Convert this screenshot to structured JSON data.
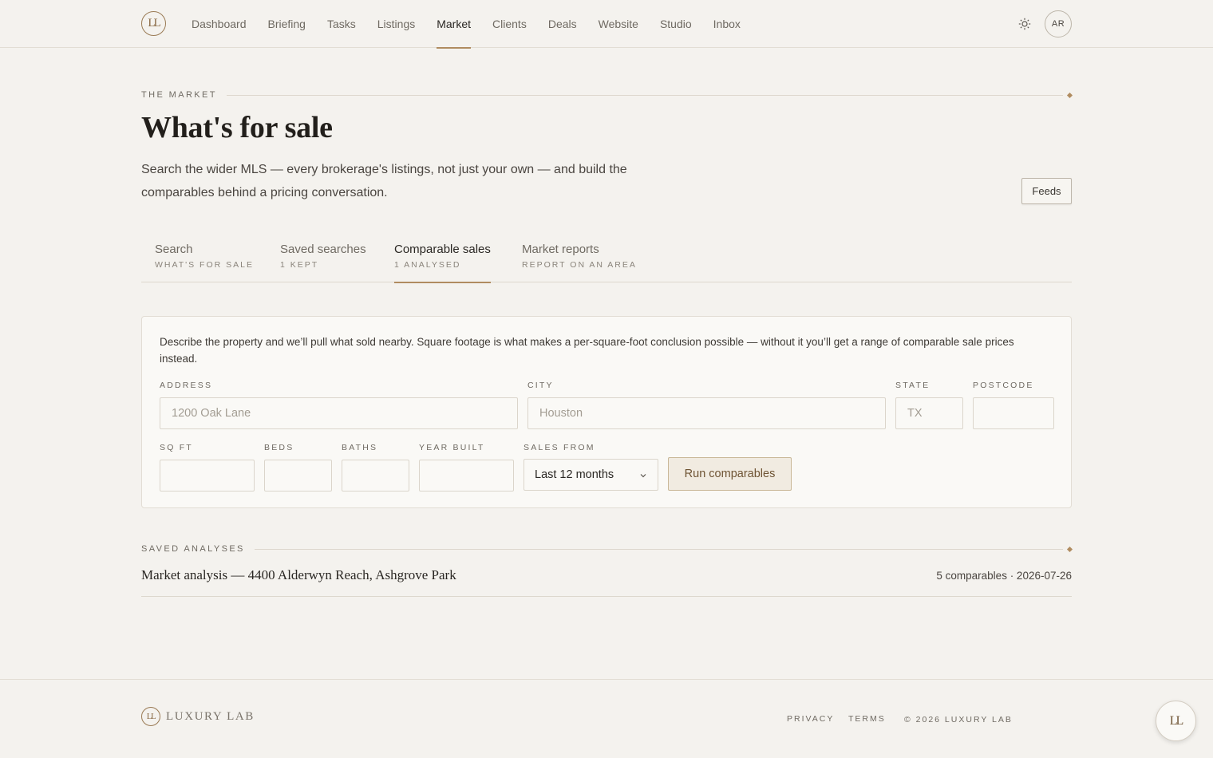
{
  "brand": {
    "logo_mark": "LL",
    "footer_name": "LUXURY LAB"
  },
  "nav": {
    "items": [
      {
        "label": "Dashboard"
      },
      {
        "label": "Briefing"
      },
      {
        "label": "Tasks"
      },
      {
        "label": "Listings"
      },
      {
        "label": "Market",
        "active": true
      },
      {
        "label": "Clients"
      },
      {
        "label": "Deals"
      },
      {
        "label": "Website"
      },
      {
        "label": "Studio"
      },
      {
        "label": "Inbox"
      }
    ],
    "theme_icon": "sun-icon",
    "avatar_initials": "AR"
  },
  "header": {
    "eyebrow": "THE MARKET",
    "title": "What's for sale",
    "intro": "Search the wider MLS — every brokerage's listings, not just your own — and build the comparables behind a pricing conversation.",
    "feeds_label": "Feeds"
  },
  "tabs": [
    {
      "label": "Search",
      "sub": "WHAT'S FOR SALE"
    },
    {
      "label": "Saved searches",
      "sub": "1 KEPT"
    },
    {
      "label": "Comparable sales",
      "sub": "1 ANALYSED",
      "active": true
    },
    {
      "label": "Market reports",
      "sub": "REPORT ON AN AREA"
    }
  ],
  "form": {
    "description": "Describe the property and we’ll pull what sold nearby. Square footage is what makes a per-square-foot conclusion possible — without it you’ll get a range of comparable sale prices instead.",
    "address": {
      "label": "ADDRESS",
      "placeholder": "1200 Oak Lane",
      "value": ""
    },
    "city": {
      "label": "CITY",
      "placeholder": "Houston",
      "value": ""
    },
    "state": {
      "label": "STATE",
      "placeholder": "TX",
      "value": ""
    },
    "postcode": {
      "label": "POSTCODE",
      "placeholder": "",
      "value": ""
    },
    "sqft": {
      "label": "SQ FT",
      "value": ""
    },
    "beds": {
      "label": "BEDS",
      "value": ""
    },
    "baths": {
      "label": "BATHS",
      "value": ""
    },
    "year_built": {
      "label": "YEAR BUILT",
      "value": ""
    },
    "sales_from": {
      "label": "SALES FROM",
      "selected": "Last 12 months"
    },
    "run_label": "Run comparables"
  },
  "saved_analyses": {
    "eyebrow": "SAVED ANALYSES",
    "items": [
      {
        "title": "Market analysis — 4400 Alderwyn Reach, Ashgrove Park",
        "meta": "5 comparables · 2026-07-26"
      }
    ]
  },
  "footer": {
    "privacy": "PRIVACY",
    "terms": "TERMS",
    "copyright": "© 2026 LUXURY LAB"
  },
  "colors": {
    "accent": "#b08c60",
    "background": "#f4f2ee",
    "text": "#2a2723"
  }
}
